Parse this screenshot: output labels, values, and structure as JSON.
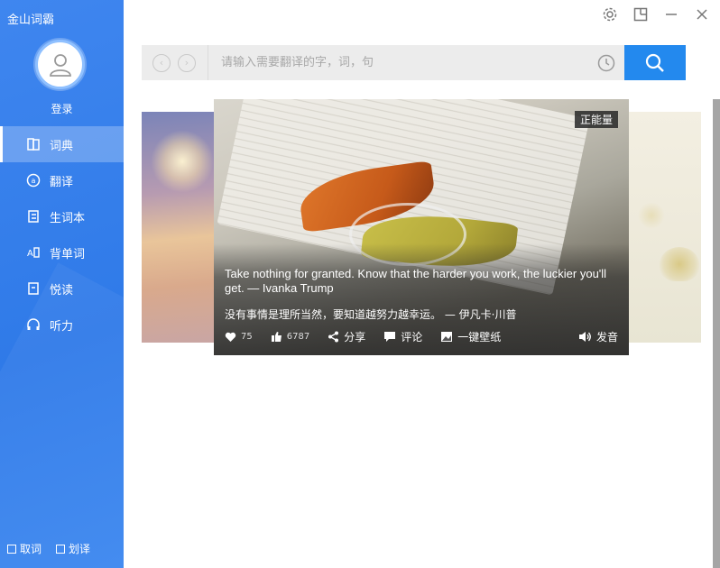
{
  "app": {
    "title": "金山词霸"
  },
  "user": {
    "login_label": "登录"
  },
  "sidebar": {
    "items": [
      {
        "label": "词典",
        "icon": "dictionary-icon",
        "active": true
      },
      {
        "label": "翻译",
        "icon": "translate-icon",
        "active": false
      },
      {
        "label": "生词本",
        "icon": "wordbook-icon",
        "active": false
      },
      {
        "label": "背单词",
        "icon": "memorize-icon",
        "active": false
      },
      {
        "label": "悦读",
        "icon": "reading-icon",
        "active": false
      },
      {
        "label": "听力",
        "icon": "headphones-icon",
        "active": false
      }
    ],
    "bottom": {
      "pick_label": "取词",
      "select_label": "划译"
    }
  },
  "search": {
    "placeholder": "请输入需要翻译的字，词，句"
  },
  "card": {
    "tag": "正能量",
    "quote_en": "Take nothing for granted. Know that the harder you work, the luckier you'll get. — Ivanka Trump",
    "quote_zh": "没有事情是理所当然，要知道越努力越幸运。 — 伊凡卡·川普",
    "likes": "75",
    "thumbs": "6787",
    "share_label": "分享",
    "comment_label": "评论",
    "wallpaper_label": "一键壁纸",
    "speak_label": "发音"
  },
  "colors": {
    "sidebar": "#3a82ee",
    "accent": "#2389ee"
  }
}
